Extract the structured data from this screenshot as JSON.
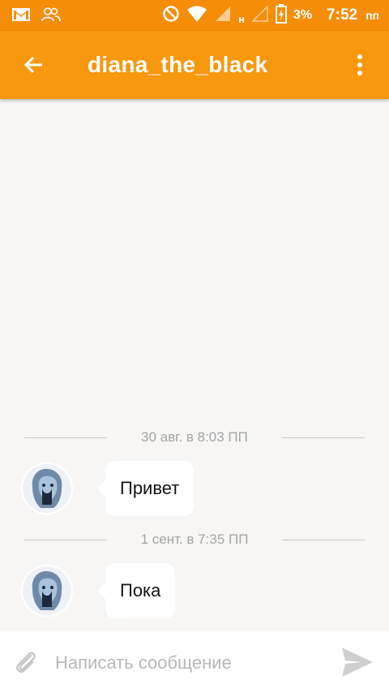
{
  "status_bar": {
    "network_label": "н",
    "battery": "3%",
    "time": "7:52",
    "ampm": "пп"
  },
  "toolbar": {
    "title": "diana_the_black"
  },
  "messages": [
    {
      "date": "30 авг. в 8:03 ПП",
      "text": "Привет"
    },
    {
      "date": "1 сент. в 7:35 ПП",
      "text": "Пока"
    }
  ],
  "composer": {
    "placeholder": "Написать сообщение"
  },
  "colors": {
    "accent": "#f7980f",
    "statusbar": "#f58d08",
    "background": "#f7f6f4"
  }
}
